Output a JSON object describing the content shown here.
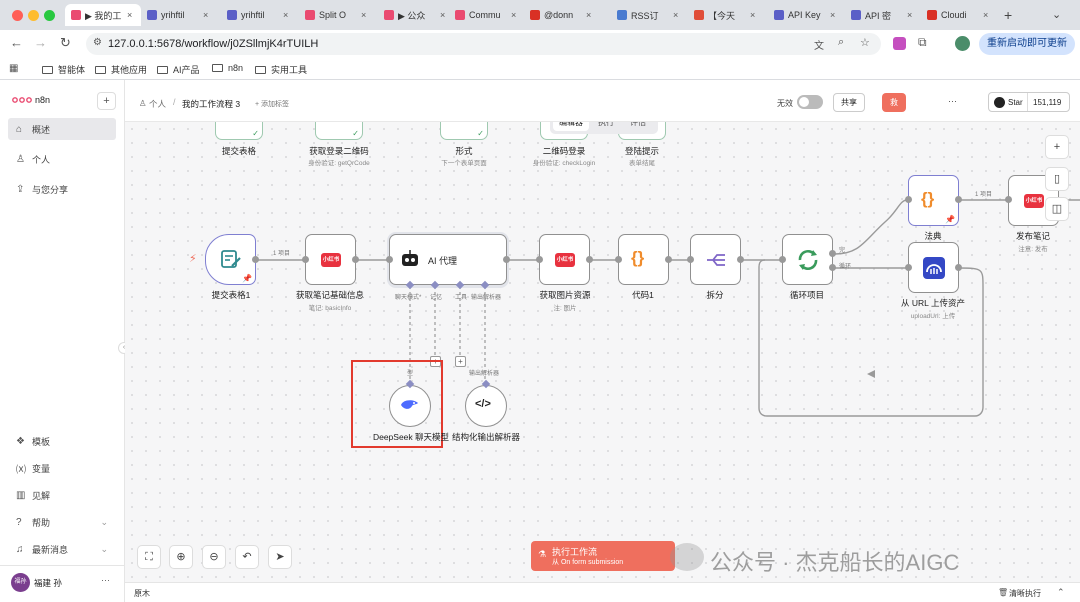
{
  "browser": {
    "tabs": [
      {
        "label": "▶ 我的工",
        "color": "#ea4b71",
        "active": true
      },
      {
        "label": "yrihftil",
        "color": "#5b5fc7"
      },
      {
        "label": "yrihftil",
        "color": "#5b5fc7"
      },
      {
        "label": "Split O",
        "color": "#ea4b71"
      },
      {
        "label": "▶ 公众",
        "color": "#ea4b71"
      },
      {
        "label": "Commu",
        "color": "#ea4b71"
      },
      {
        "label": "@donn",
        "color": "#d93025"
      },
      {
        "label": "RSS订",
        "color": "#4a7bd0"
      },
      {
        "label": "【今天",
        "color": "#e04e39"
      },
      {
        "label": "API Key",
        "color": "#5b5fc7"
      },
      {
        "label": "API 密",
        "color": "#5b5fc7"
      },
      {
        "label": "Cloudi",
        "color": "#d93025"
      }
    ],
    "url": "127.0.0.1:5678/workflow/j0ZSllmjK4rTUILH",
    "restart_label": "重新启动即可更新",
    "bookmarks": [
      "智能体",
      "其他应用",
      "AI产品",
      "n8n",
      "实用工具"
    ]
  },
  "sidebar": {
    "brand": "n8n",
    "add_symbol": "+",
    "items": [
      {
        "label": "概述",
        "icon": "home-icon",
        "glyph": "⌂"
      },
      {
        "label": "个人",
        "icon": "user-icon",
        "glyph": "♙"
      },
      {
        "label": "与您分享",
        "icon": "share-icon",
        "glyph": "⇪"
      }
    ],
    "bottom_items": [
      {
        "label": "模板",
        "icon": "templates-icon",
        "glyph": "❖"
      },
      {
        "label": "变量",
        "icon": "variables-icon",
        "glyph": "⒳"
      },
      {
        "label": "见解",
        "icon": "insights-icon",
        "glyph": "▥"
      },
      {
        "label": "帮助",
        "icon": "help-icon",
        "glyph": "?"
      },
      {
        "label": "最新消息",
        "icon": "bell-icon",
        "glyph": "♫"
      }
    ],
    "user": {
      "name": "福建 孙",
      "avatar_text": "福孙"
    },
    "more": "···"
  },
  "header": {
    "breadcrumb_owner": "个人",
    "separator": "/",
    "workflow_name": "我的工作流程 3",
    "add_tag": "+ 添加标签",
    "inactive_label": "无效",
    "share_label": "共享",
    "save_label": "救",
    "more": "···",
    "tabs": [
      "编辑器",
      "执行",
      "评估"
    ],
    "active_tab": "编辑器",
    "github": {
      "label": "Star",
      "count": "151,119"
    }
  },
  "nodes": {
    "top_row": [
      {
        "label": "提交表格",
        "sub": ""
      },
      {
        "label": "获取登录二维码",
        "sub": "身份验证: getQrCode"
      },
      {
        "label": "形式",
        "sub": "下一个表单页面"
      },
      {
        "label": "二维码登录",
        "sub": "身份验证: checkLogin"
      },
      {
        "label": "登陆提示",
        "sub": "表单结尾"
      }
    ],
    "form_trigger": {
      "label": "提交表格1"
    },
    "get_note": {
      "label": "获取笔记基础信息",
      "sub": "笔记: basicInfo",
      "badge": "小红书"
    },
    "agent": {
      "label": "AI 代理",
      "ports": [
        "聊天模式*",
        "记忆",
        "工具",
        "输出解析器"
      ]
    },
    "get_image": {
      "label": "获取图片资源",
      "sub": "注: 图片",
      "badge": "小红书"
    },
    "code1": {
      "label": "代码1"
    },
    "split": {
      "label": "拆分"
    },
    "loop": {
      "label": "循环项目",
      "out_done": "完",
      "out_loop": "循环"
    },
    "dict": {
      "label": "法典"
    },
    "upload": {
      "label": "从 URL 上传资产",
      "sub": "uploadUrl: 上传"
    },
    "publish": {
      "label": "发布笔记",
      "sub": "注意: 发布",
      "badge": "小红书"
    },
    "deepseek": {
      "label": "DeepSeek 聊天模型",
      "port": "型"
    },
    "parser": {
      "label": "结构化输出解析器",
      "port": "输出解析器"
    }
  },
  "edges": {
    "item1": "1 项目",
    "item2": "1 项目"
  },
  "execute": {
    "title": "执行工作流",
    "sub": "从 On form submission"
  },
  "watermark": "公众号 · 杰克船长的AIGC",
  "status_left": "原木",
  "status_right": "清晰执行"
}
